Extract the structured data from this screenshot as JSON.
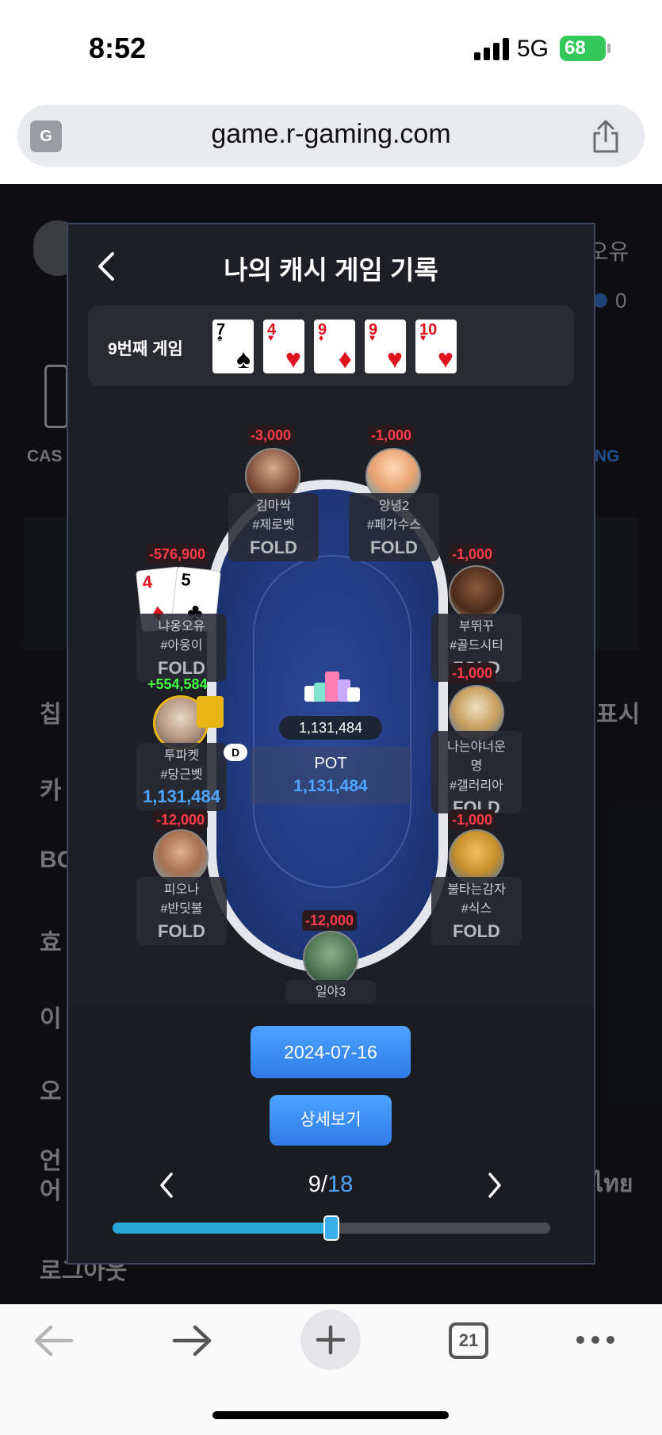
{
  "status_bar": {
    "time": "8:52",
    "network": "5G",
    "battery": "68"
  },
  "browser": {
    "url": "game.r-gaming.com",
    "tab_count": "21"
  },
  "background_app": {
    "header_name": "오유",
    "coin_value": "0",
    "left_tile_label": "CAS",
    "right_tile_label": "NG",
    "menu": [
      {
        "label": "칩",
        "right": "표시"
      },
      {
        "label": "카"
      },
      {
        "label": "BG"
      },
      {
        "label": "효"
      },
      {
        "label": "이"
      },
      {
        "label": "오"
      },
      {
        "label": "언\n어",
        "right": "ไทย"
      },
      {
        "label": "로그아웃"
      }
    ]
  },
  "modal": {
    "title": "나의 캐시 게임 기록",
    "board_label": "9번째 게임",
    "board_cards": [
      {
        "rank": "7",
        "suit": "♠",
        "color": "#000000"
      },
      {
        "rank": "4",
        "suit": "♥",
        "color": "#e0121e"
      },
      {
        "rank": "9",
        "suit": "♦",
        "color": "#e0121e"
      },
      {
        "rank": "9",
        "suit": "♥",
        "color": "#e0121e"
      },
      {
        "rank": "10",
        "suit": "♥",
        "color": "#e0121e"
      }
    ],
    "pot_chip_amount": "1,131,484",
    "pot_label": "POT",
    "pot_value": "1,131,484",
    "seats": [
      {
        "bet": "-3,000",
        "name": "김마싹",
        "tag": "#제로벳",
        "status": "FOLD"
      },
      {
        "bet": "-1,000",
        "name": "앙녕2",
        "tag": "#페가수스",
        "status": "FOLD"
      },
      {
        "bet": "-576,900",
        "name": "냐옹오유",
        "tag": "#아웅이",
        "status": "FOLD",
        "hole_cards": [
          {
            "rank": "4",
            "suit": "♦",
            "color": "#e0121e"
          },
          {
            "rank": "5",
            "suit": "♣",
            "color": "#000000"
          }
        ]
      },
      {
        "bet": "-1,000",
        "name": "부뛰꾸",
        "tag": "#골드시티",
        "status": "FOLD"
      },
      {
        "win": "+554,584",
        "name": "투파켓",
        "tag": "#당근벳",
        "chips": "1,131,484",
        "dealer": "D"
      },
      {
        "bet": "-1,000",
        "name": "나는야너운",
        "name2": "명",
        "tag": "#갤러리아",
        "status": "FOLD"
      },
      {
        "bet": "-12,000",
        "name": "피오나",
        "tag": "#반딧불",
        "status": "FOLD"
      },
      {
        "bet": "-1,000",
        "name": "불타는감자",
        "tag": "#식스",
        "status": "FOLD"
      },
      {
        "bet": "-12,000",
        "name": "일야3"
      }
    ],
    "date_button": "2024-07-16",
    "detail_button": "상세보기",
    "pager": {
      "current": "9",
      "separator": "/",
      "total": "18"
    },
    "progress": 0.5
  },
  "colors": {
    "accent": "#4da6ff",
    "loss": "#ff3b4a",
    "win": "#44ff44",
    "felt": "#20397e"
  },
  "icons": [
    "translate-icon",
    "share-icon",
    "back-chevron-icon",
    "chevron-left-icon",
    "chevron-right-icon",
    "nav-back-icon",
    "nav-forward-icon",
    "plus-icon",
    "tabs-icon",
    "more-icon"
  ]
}
